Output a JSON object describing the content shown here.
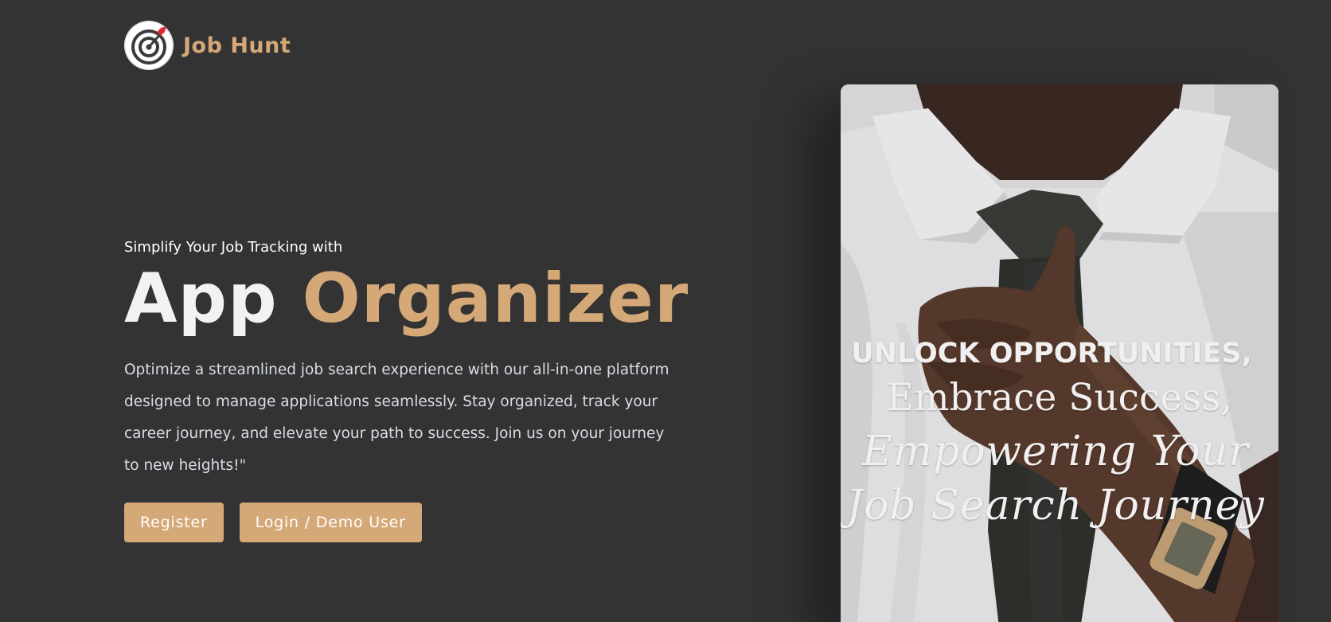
{
  "brand": {
    "name": "Job Hunt"
  },
  "hero": {
    "subtitle": "Simplify Your Job Tracking with",
    "title_part1": "App",
    "title_part2": "Organizer",
    "description": "Optimize a streamlined job search experience with our all-in-one platform designed to manage applications seamlessly. Stay organized, track your career journey, and elevate your path to success. Join us on your journey to new heights!\""
  },
  "buttons": {
    "register": "Register",
    "login": "Login / Demo User"
  },
  "card": {
    "line1": "UNLOCK OPPORTUNITIES,",
    "line2": "Embrace Success,",
    "line3": "Empowering Your",
    "line4": "Job Search Journey"
  },
  "colors": {
    "background": "#333333",
    "accent": "#d4a877",
    "text": "#ffffff"
  },
  "icons": {
    "logo": "target-with-arrow-icon"
  }
}
